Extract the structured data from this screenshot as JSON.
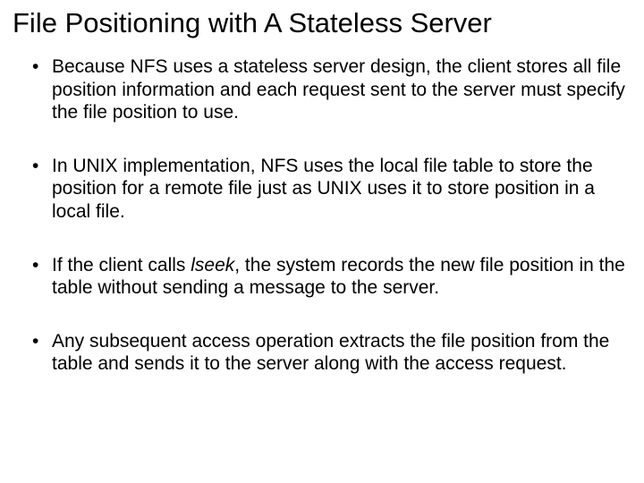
{
  "title": "File Positioning with A Stateless Server",
  "bullets": {
    "b0": {
      "pre": "Because NFS uses a stateless server design, the client stores all file position information and each request sent to the server must specify the file position to use."
    },
    "b1": {
      "pre": "In UNIX implementation, NFS uses the local file table to store the position for a remote file just as UNIX uses it to store position in a local file."
    },
    "b2": {
      "pre": "If the client calls ",
      "ital": "lseek",
      "post": ", the system records the new file position in the table without sending a message to the server."
    },
    "b3": {
      "pre": "Any subsequent access operation extracts the file position from the table and sends it to the server along with the access request."
    }
  }
}
